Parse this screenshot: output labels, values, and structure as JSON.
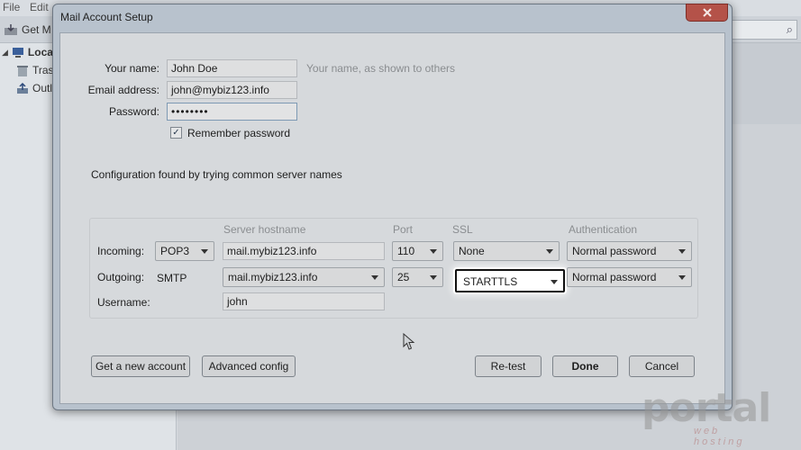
{
  "background": {
    "menu": [
      "File",
      "Edit"
    ],
    "get_mail": "Get M",
    "tree": [
      "Local",
      "Tras",
      "Outl"
    ]
  },
  "dialog": {
    "title": "Mail Account Setup",
    "close_label": "x",
    "name_label": "Your name:",
    "name_value": "John Doe",
    "name_hint": "Your name, as shown to others",
    "email_label": "Email address:",
    "email_value": "john@mybiz123.info",
    "password_label": "Password:",
    "password_value": "••••••••",
    "remember_label": "Remember password",
    "remember_checked": true,
    "status": "Configuration found by trying common server names",
    "columns": {
      "hostname": "Server hostname",
      "port": "Port",
      "ssl": "SSL",
      "auth": "Authentication"
    },
    "incoming": {
      "label": "Incoming:",
      "protocol": "POP3",
      "hostname": "mail.mybiz123.info",
      "port": "110",
      "ssl": "None",
      "auth": "Normal password"
    },
    "outgoing": {
      "label": "Outgoing:",
      "protocol": "SMTP",
      "hostname": "mail.mybiz123.info",
      "port": "25",
      "ssl": "STARTTLS",
      "auth": "Normal password"
    },
    "username": {
      "label": "Username:",
      "value": "john"
    },
    "buttons": {
      "new_account": "Get a new account",
      "advanced": "Advanced config",
      "retest": "Re-test",
      "done": "Done",
      "cancel": "Cancel"
    }
  },
  "watermark": {
    "main": "portal",
    "sub": "web hosting"
  }
}
